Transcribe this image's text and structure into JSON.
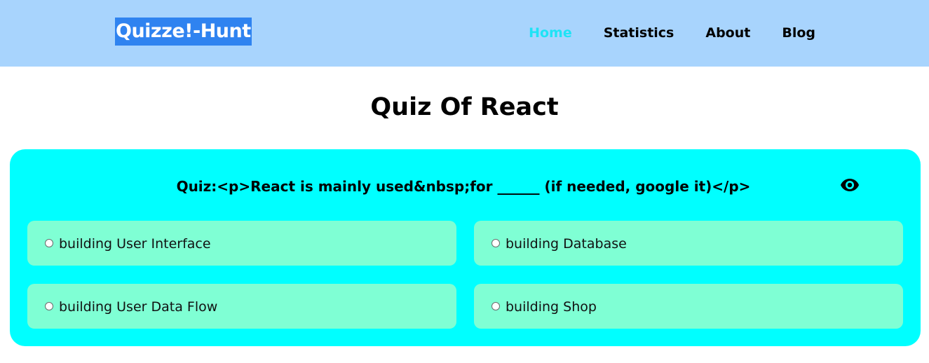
{
  "navbar": {
    "brand": "Quizze!-Hunt",
    "links": [
      {
        "label": "Home",
        "active": true
      },
      {
        "label": "Statistics",
        "active": false
      },
      {
        "label": "About",
        "active": false
      },
      {
        "label": "Blog",
        "active": false
      }
    ],
    "active_color": "#1ee3f5",
    "background": "#a8d4fd",
    "brand_highlight": "#2f83f0"
  },
  "page": {
    "title": "Quiz Of React"
  },
  "quiz": {
    "question": "Quiz:<p>React is mainly used&nbsp;for ______ (if needed, google it)</p>",
    "toggle_icon": "eye-icon",
    "card_color": "#00ffff",
    "option_color": "#7fffd4",
    "options": [
      {
        "label": "building User Interface",
        "checked": false
      },
      {
        "label": "building Database",
        "checked": false
      },
      {
        "label": "building User Data Flow",
        "checked": false
      },
      {
        "label": "building Shop",
        "checked": false
      }
    ]
  }
}
